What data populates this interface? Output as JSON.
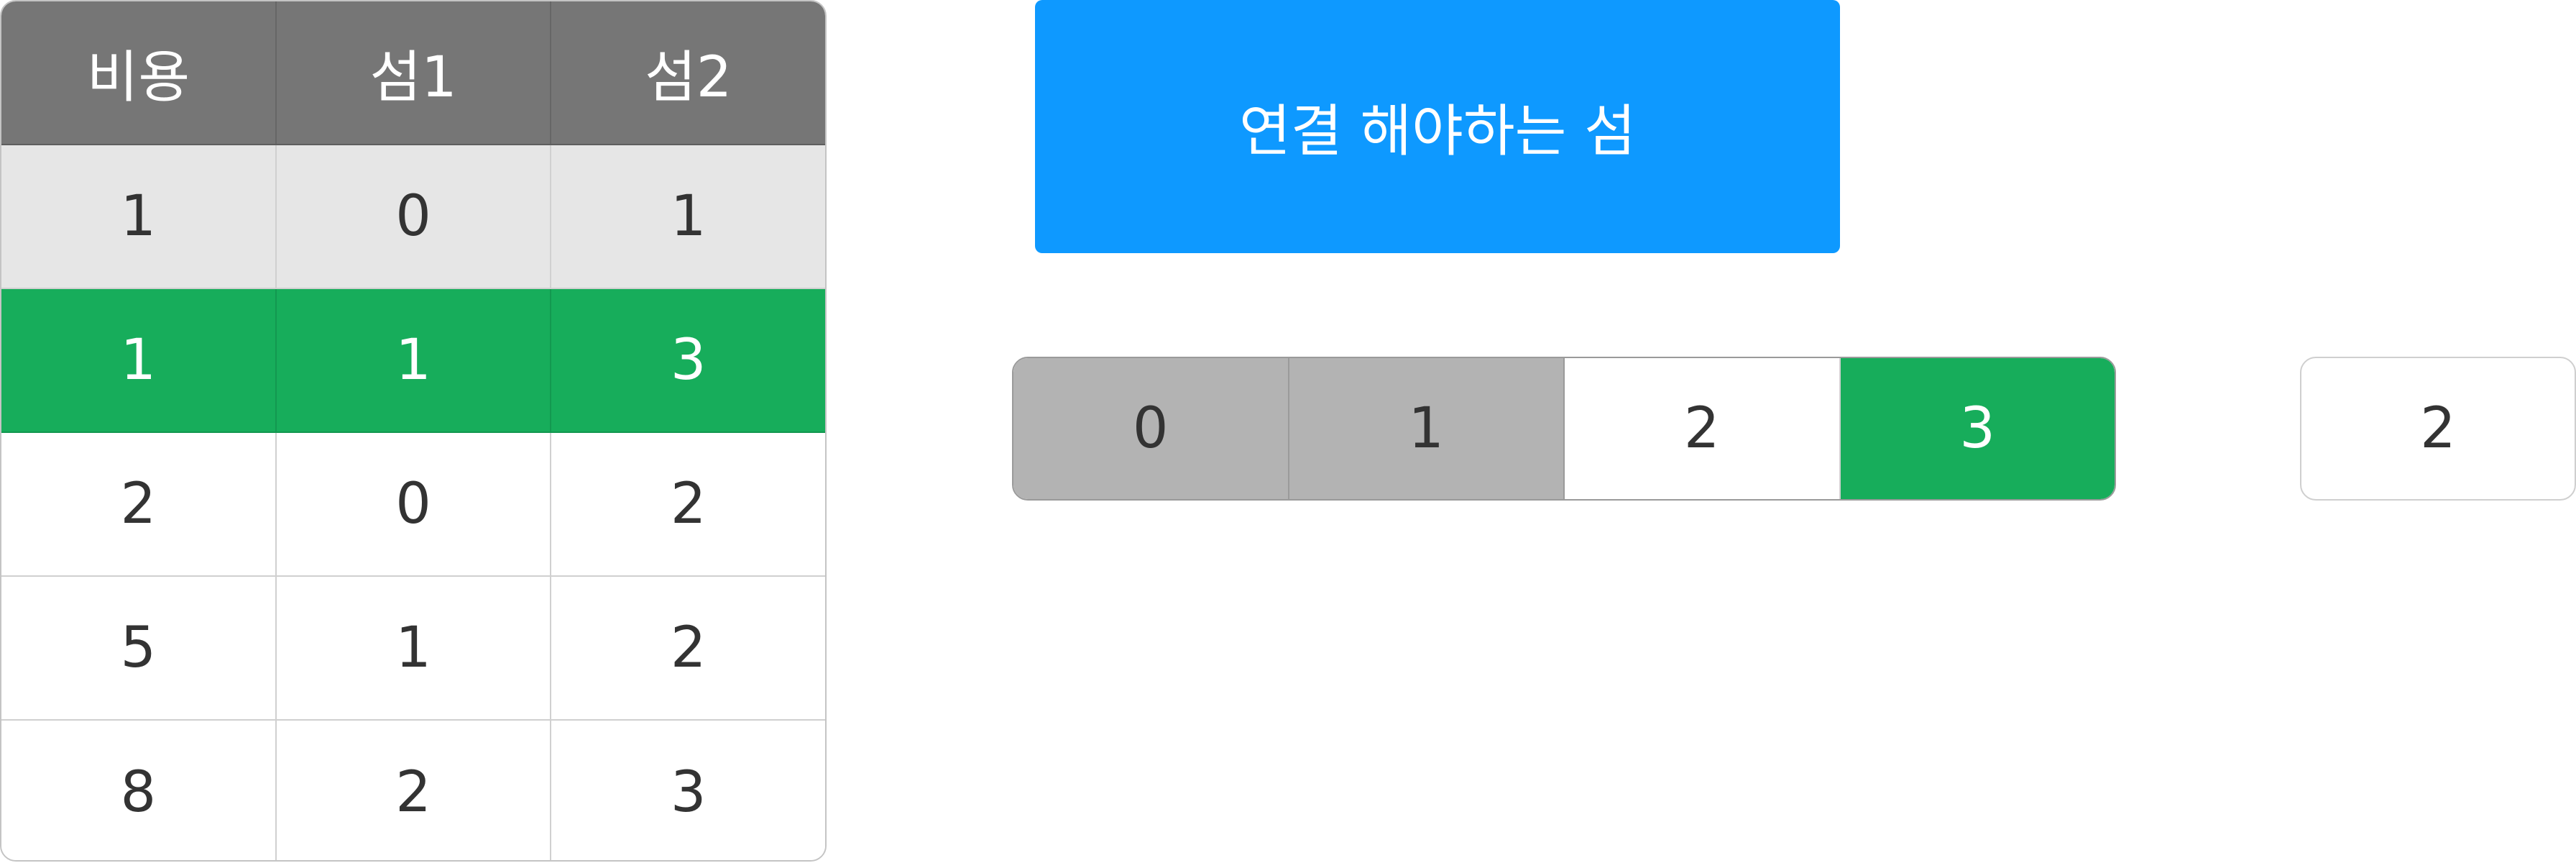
{
  "table": {
    "headers": [
      "비용",
      "섬1",
      "섬2"
    ],
    "rows": [
      {
        "state": "done",
        "cells": [
          "1",
          "0",
          "1"
        ]
      },
      {
        "state": "active",
        "cells": [
          "1",
          "1",
          "3"
        ]
      },
      {
        "state": "pending",
        "cells": [
          "2",
          "0",
          "2"
        ]
      },
      {
        "state": "pending",
        "cells": [
          "5",
          "1",
          "2"
        ]
      },
      {
        "state": "pending",
        "cells": [
          "8",
          "2",
          "3"
        ]
      }
    ]
  },
  "title": "연결 해야하는 섬",
  "islands": [
    {
      "label": "0",
      "state": "connected"
    },
    {
      "label": "1",
      "state": "connected"
    },
    {
      "label": "2",
      "state": "unconnected"
    },
    {
      "label": "3",
      "state": "selected"
    }
  ],
  "side_value": "2",
  "colors": {
    "header": "#767676",
    "done_row": "#e6e6e6",
    "active": "#17ad5b",
    "title_box": "#0e99ff",
    "connected": "#b3b3b3"
  }
}
